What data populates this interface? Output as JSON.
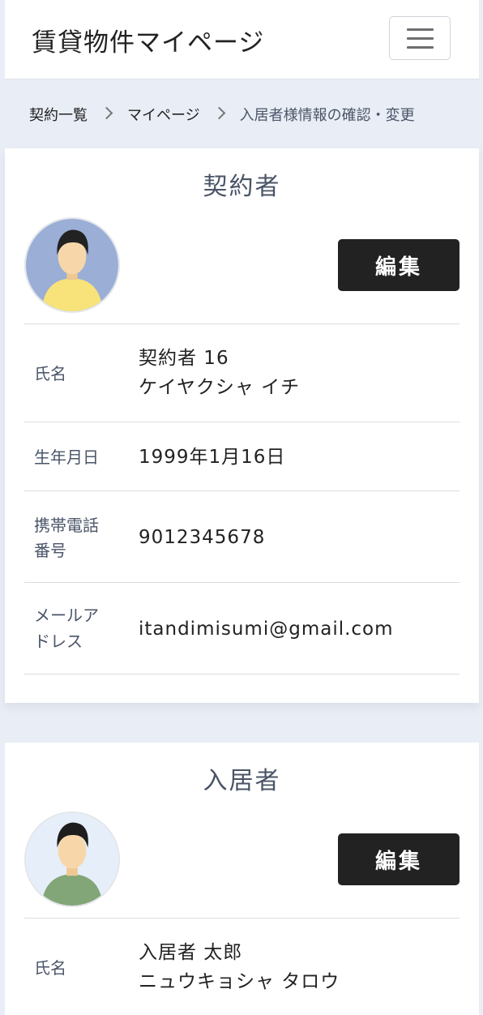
{
  "header": {
    "title": "賃貸物件マイページ",
    "menu_icon": "hamburger-menu-icon"
  },
  "breadcrumb": [
    "契約一覧",
    "マイページ",
    "入居者様情報の確認・変更"
  ],
  "contractor": {
    "title": "契約者",
    "edit_label": "編集",
    "avatar_colors": {
      "background": "#9aaed6",
      "shirt": "#f7e37a",
      "hair": "#222222",
      "skin": "#f7d7aa"
    },
    "rows": [
      {
        "label": "氏名",
        "value_lines": [
          "契約者 16",
          "ケイヤクシャ イチ"
        ]
      },
      {
        "label": "生年月日",
        "value_lines": [
          "1999年1月16日"
        ]
      },
      {
        "label_lines": [
          "携帯電話",
          "番号"
        ],
        "value_lines": [
          "9012345678"
        ]
      },
      {
        "label_lines": [
          "メールア",
          "ドレス"
        ],
        "value_lines": [
          "itandimisumi@gmail.com"
        ]
      }
    ]
  },
  "resident": {
    "title": "入居者",
    "edit_label": "編集",
    "avatar_colors": {
      "background": "#e6eefa",
      "shirt": "#82a677",
      "hair": "#1d1d1d",
      "skin": "#f7d7aa"
    },
    "rows": [
      {
        "label": "氏名",
        "value_lines": [
          "入居者 太郎",
          "ニュウキョシャ タロウ"
        ]
      }
    ]
  },
  "colors": {
    "page_background": "#e9edf5",
    "button_dark": "#222222",
    "label_text": "#4a5568"
  }
}
